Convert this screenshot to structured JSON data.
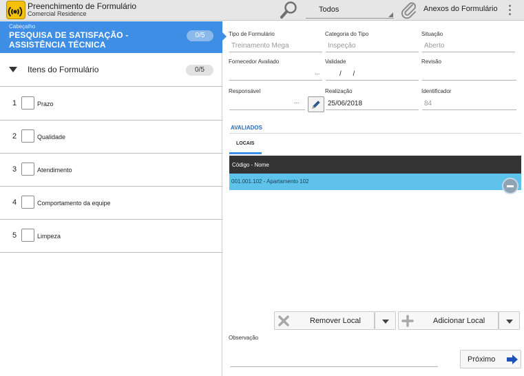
{
  "topbar": {
    "title": "Preenchimento de Formulário",
    "subtitle": "Comercial Residence",
    "filter_value": "Todos",
    "attachments_label": "Anexos do Formulário",
    "icons": {
      "logo": "radio-waves-logo-icon",
      "search": "search-icon",
      "attachments": "paperclip-icon",
      "menu": "overflow-menu-icon"
    }
  },
  "left": {
    "header_card": {
      "caption": "Cabeçalho",
      "title": "PESQUISA DE SATISFAÇÃO - ASSISTÊNCIA TÉCNICA",
      "badge": "0/5"
    },
    "items_section": {
      "title": "Itens do Formulário",
      "badge": "0/5"
    },
    "items": [
      {
        "number": "1",
        "label": "Prazo"
      },
      {
        "number": "2",
        "label": "Qualidade"
      },
      {
        "number": "3",
        "label": "Atendimento"
      },
      {
        "number": "4",
        "label": "Comportamento da equipe"
      },
      {
        "number": "5",
        "label": "Limpeza"
      }
    ]
  },
  "form": {
    "tipo_formulario": {
      "label": "Tipo de Formulário",
      "value": "Treinamento Mega"
    },
    "categoria_tipo": {
      "label": "Categoria do Tipo",
      "value": "Inspeção"
    },
    "situacao": {
      "label": "Situação",
      "value": "Aberto"
    },
    "fornecedor": {
      "label": "Fornecedor Avaliado",
      "value": "",
      "dots": "..."
    },
    "validade": {
      "label": "Validade",
      "value": "/ /"
    },
    "revisao": {
      "label": "Revisão",
      "value": ""
    },
    "responsavel": {
      "label": "Responsável",
      "value": "",
      "dots": "..."
    },
    "realizacao": {
      "label": "Realização",
      "value": "25/06/2018"
    },
    "identificador": {
      "label": "Identificador",
      "value": "84"
    }
  },
  "avaliados": {
    "title": "AVALIADOS",
    "tab_label": "LOCAIS",
    "table_header": "Código - Nome",
    "rows": [
      {
        "label": "001.001.102 - Apartamento 102"
      }
    ]
  },
  "actions": {
    "remove_label": "Remover Local",
    "add_label": "Adicionar Local",
    "observacao_label": "Observação",
    "next_label": "Próximo"
  },
  "colors": {
    "accent_blue": "#3d8ee4",
    "selected_row": "#5fc2ea",
    "table_header": "#333333",
    "logo_yellow": "#f4c20d"
  }
}
